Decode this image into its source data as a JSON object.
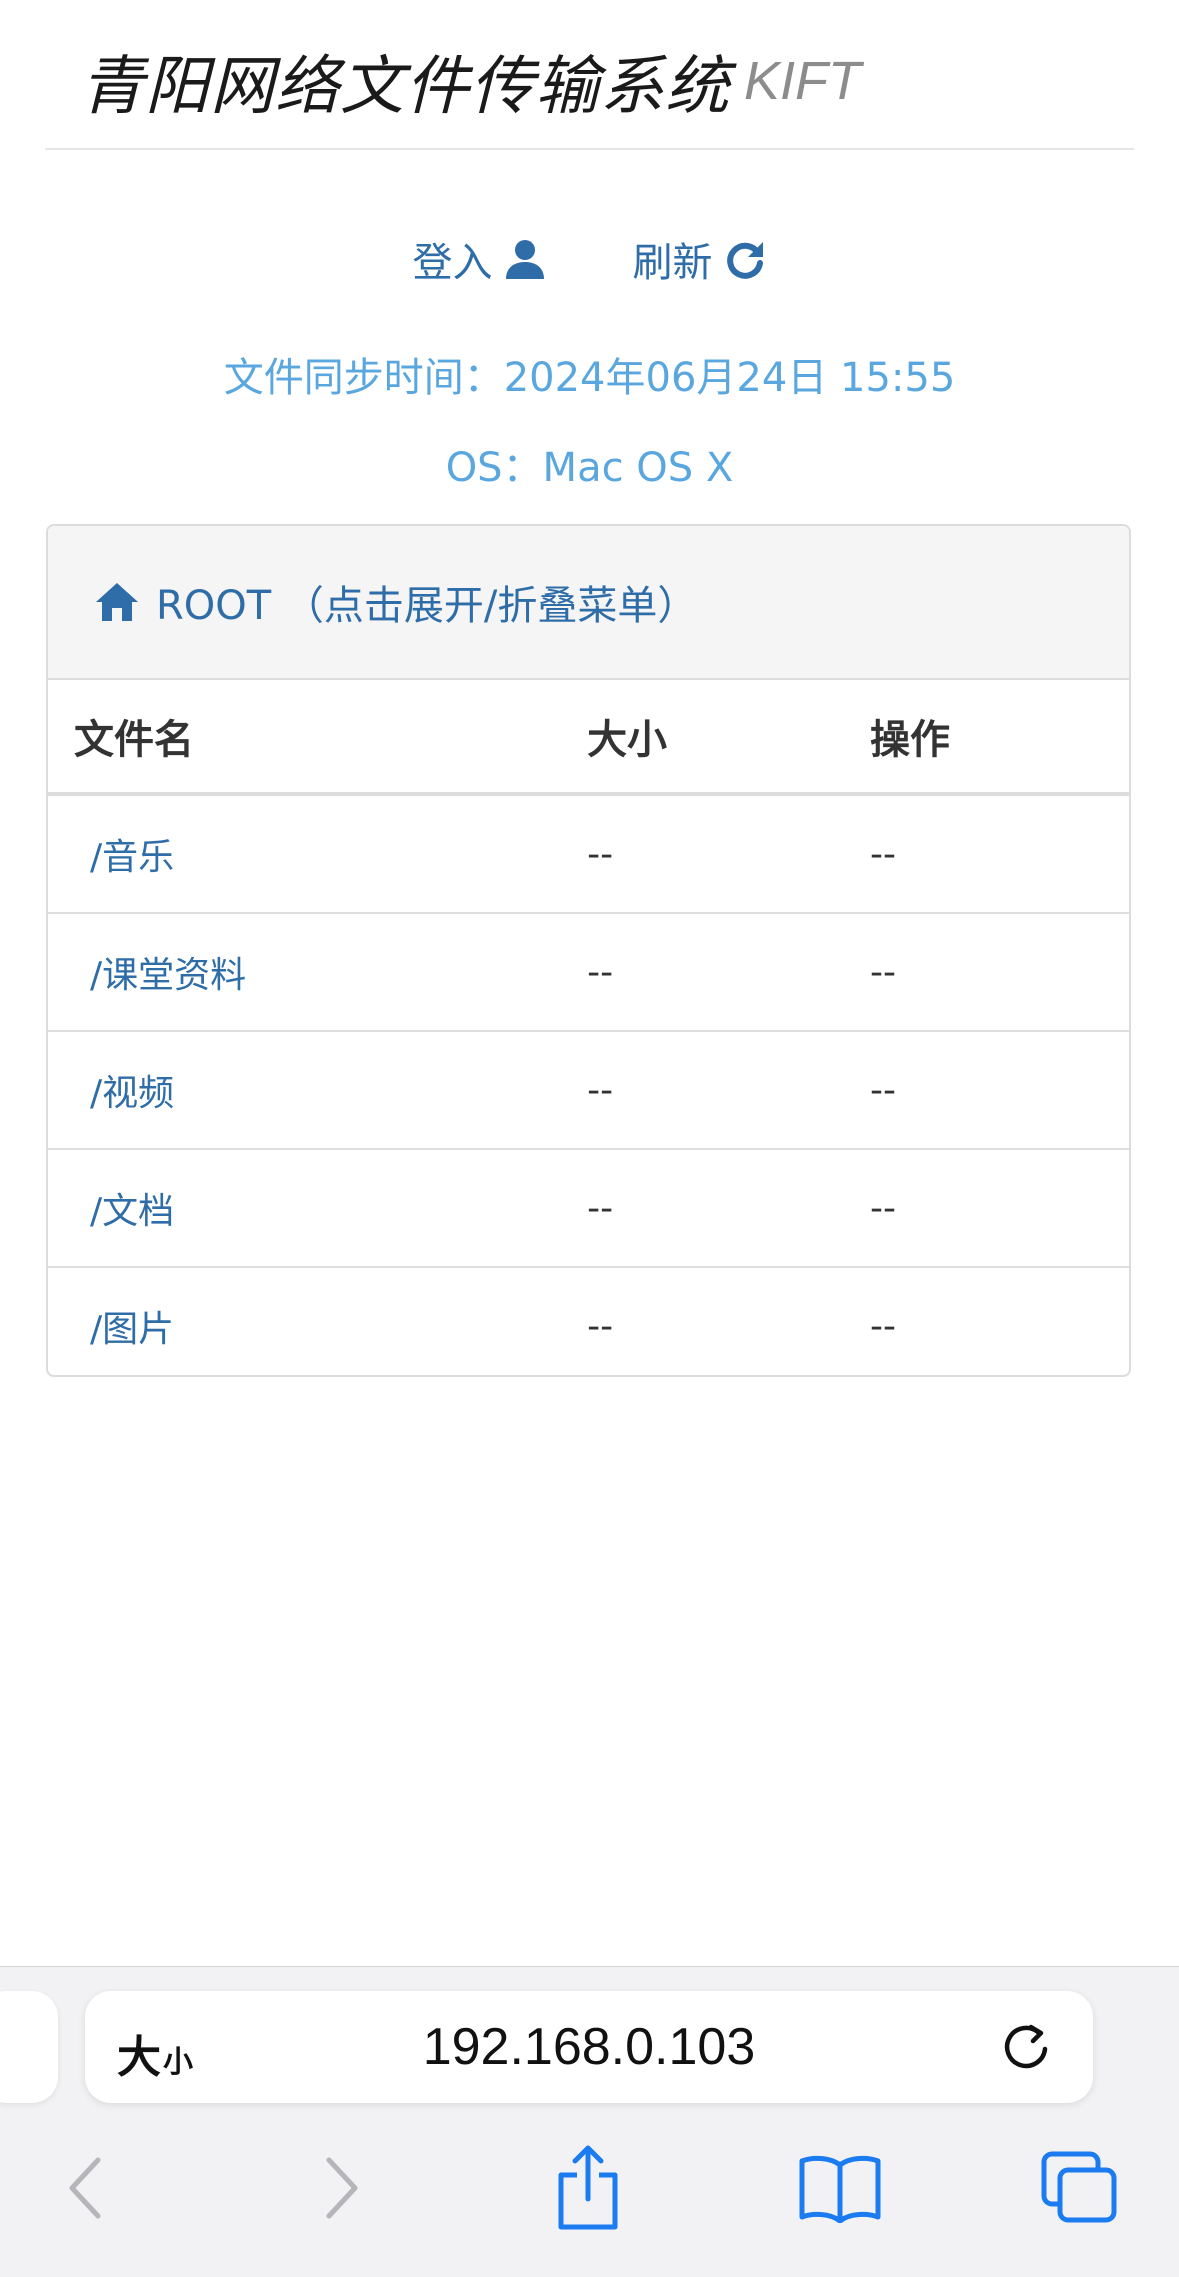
{
  "header": {
    "title": "青阳网络文件传输系统",
    "subtitle": "KIFT"
  },
  "actions": {
    "login_label": "登入",
    "refresh_label": "刷新"
  },
  "info": {
    "sync_time": "文件同步时间：2024年06月24日 15:55",
    "os": "OS：Mac OS X"
  },
  "panel": {
    "heading": "ROOT （点击展开/折叠菜单）",
    "columns": {
      "name": "文件名",
      "size": "大小",
      "action": "操作"
    },
    "rows": [
      {
        "name": "/音乐",
        "size": "--",
        "action": "--"
      },
      {
        "name": "/课堂资料",
        "size": "--",
        "action": "--"
      },
      {
        "name": "/视频",
        "size": "--",
        "action": "--"
      },
      {
        "name": "/文档",
        "size": "--",
        "action": "--"
      },
      {
        "name": "/图片",
        "size": "--",
        "action": "--"
      }
    ]
  },
  "browser": {
    "text_size_big": "大",
    "text_size_small": "小",
    "url": "192.168.0.103",
    "icons": [
      "reload-icon",
      "back-icon",
      "forward-icon",
      "share-icon",
      "bookmarks-icon",
      "tabs-icon"
    ],
    "accent_color": "#1a7cf0",
    "disabled_color": "#b5b5ba"
  },
  "colors": {
    "link": "#2f6da8",
    "info": "#5aa7df",
    "subtitle": "#8c8c8c"
  }
}
